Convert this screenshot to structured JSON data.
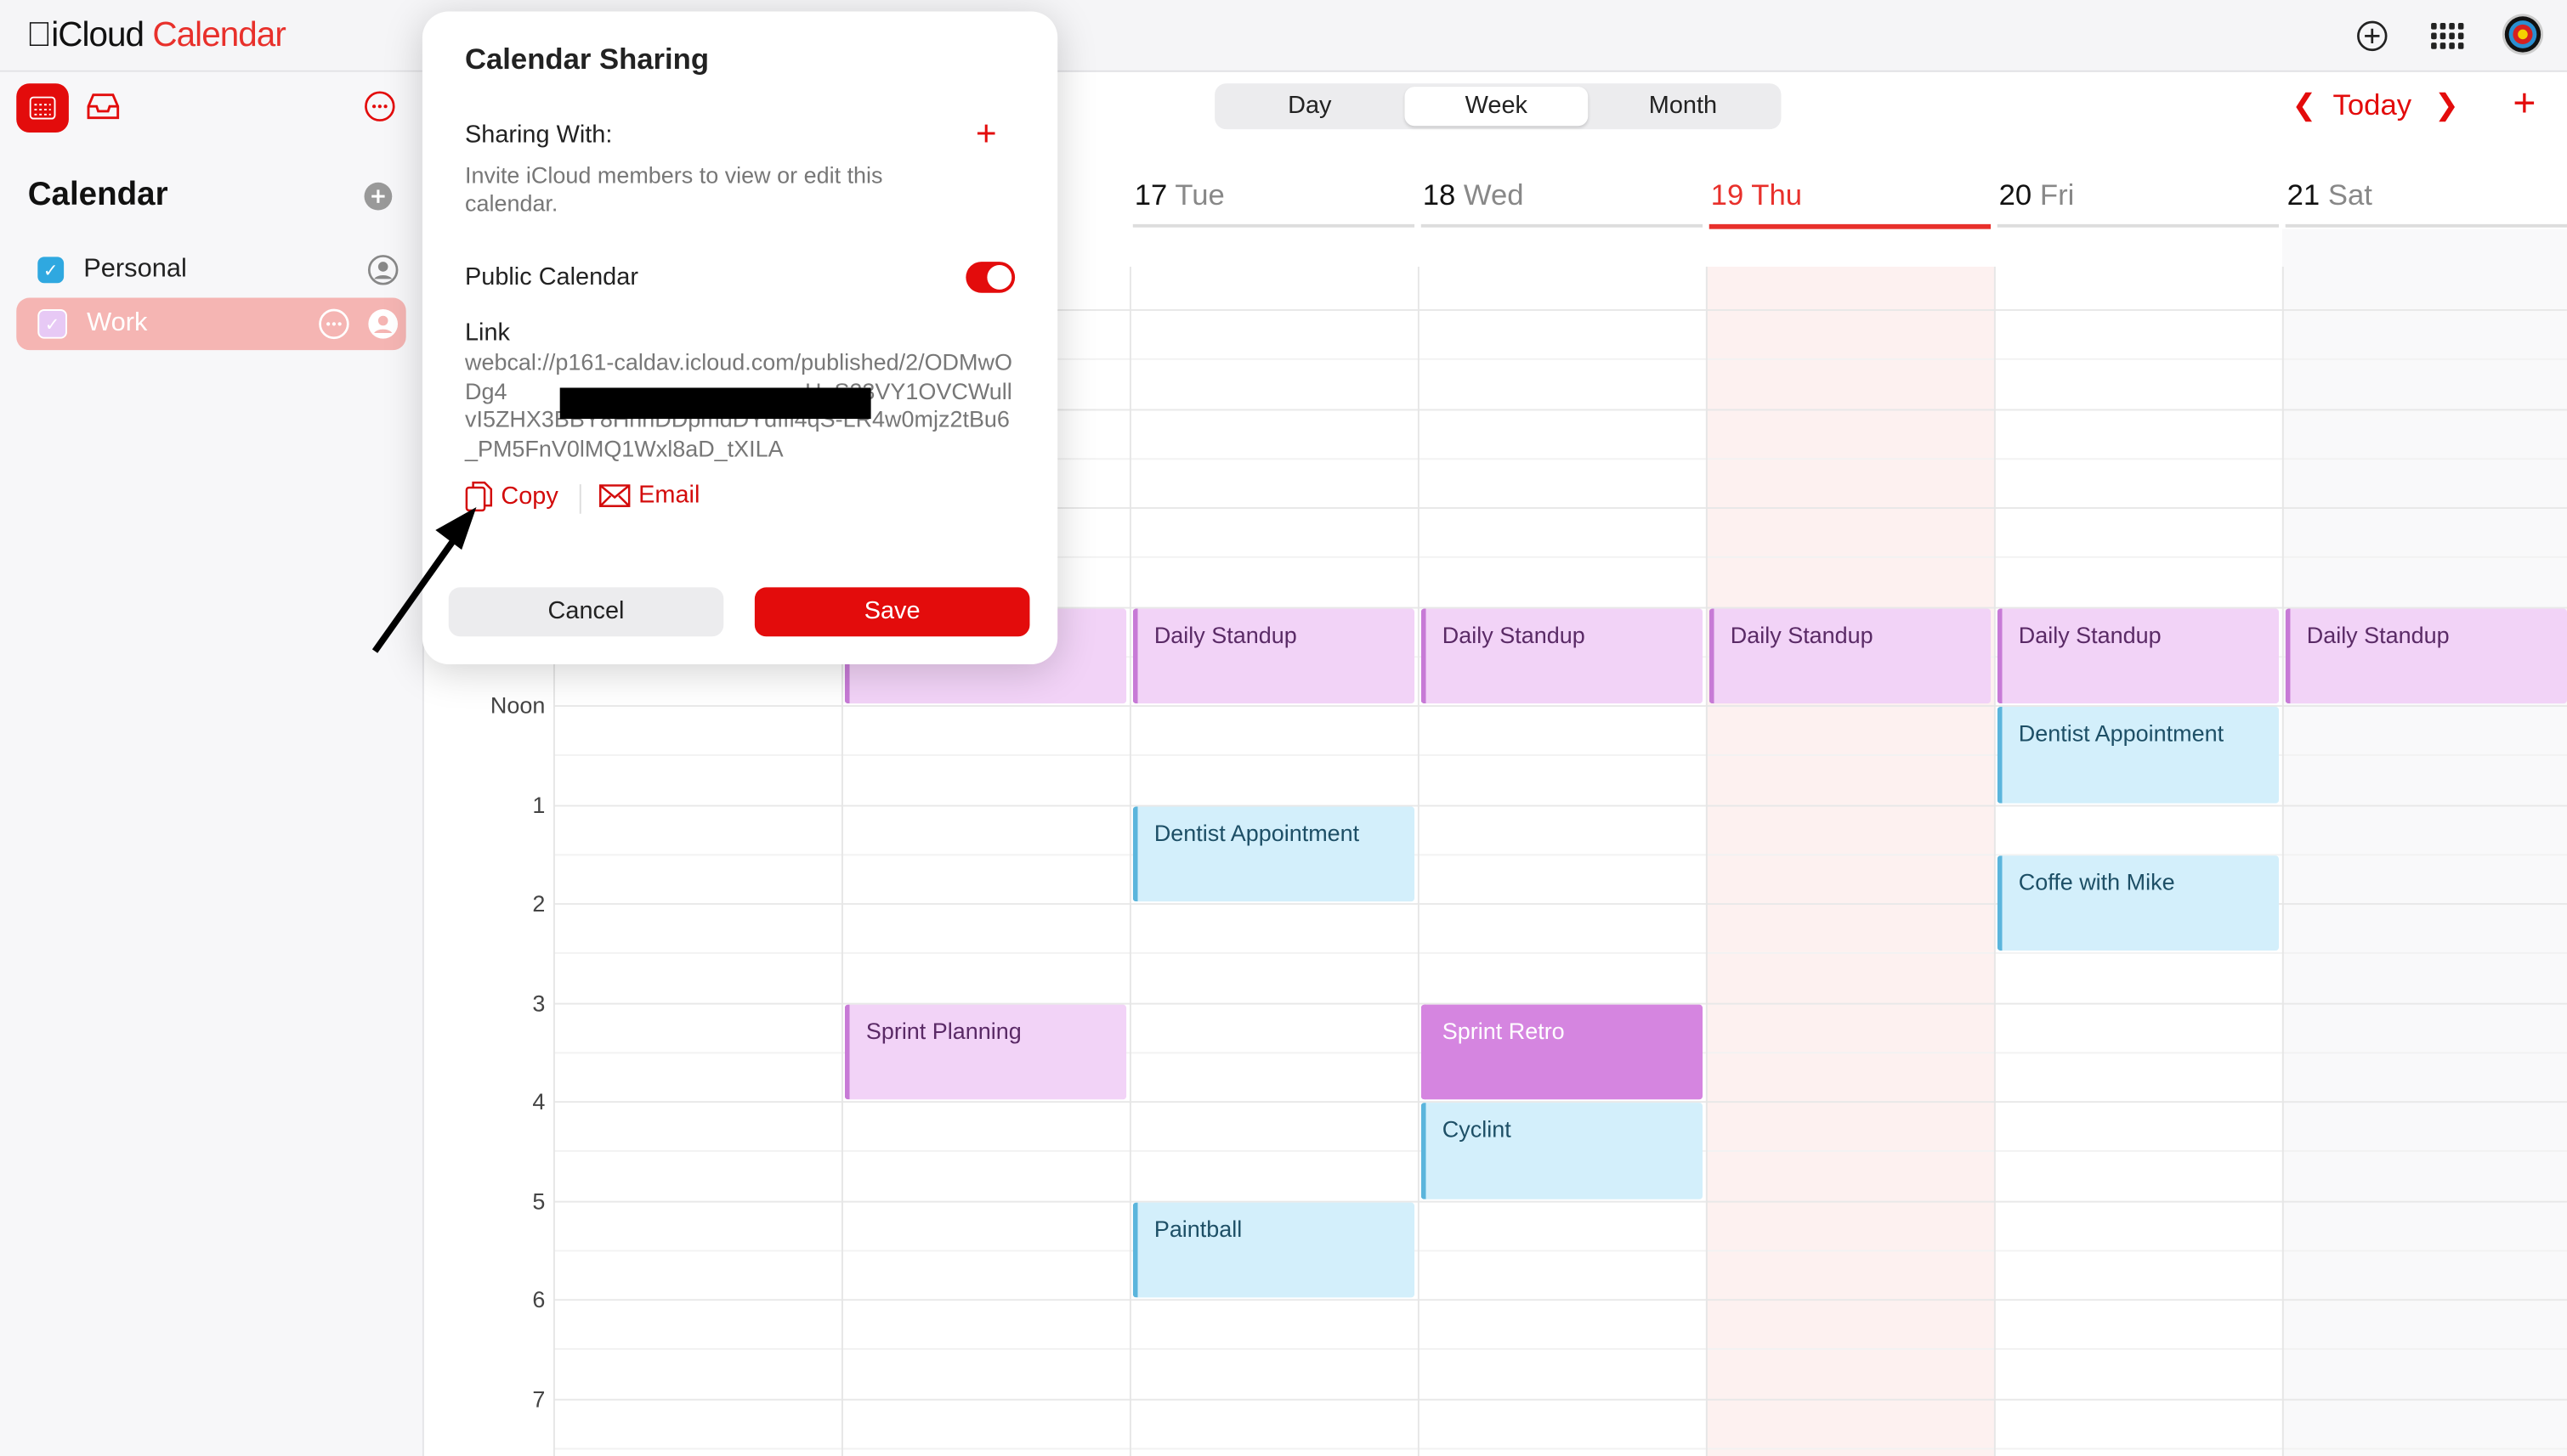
{
  "app": {
    "title_prefix": "iCloud",
    "title_name": "Calendar"
  },
  "topbar": {
    "icons": [
      "add-circle-icon",
      "app-grid-icon",
      "avatar"
    ]
  },
  "sidebar": {
    "heading": "Calendar",
    "calendars": [
      {
        "label": "Personal",
        "color": "#2fa8e0",
        "checked": true
      },
      {
        "label": "Work",
        "color": "#e7c9f5",
        "checked": true,
        "selected": true
      }
    ]
  },
  "toolbar": {
    "views": [
      "Day",
      "Week",
      "Month"
    ],
    "active_view": "Week",
    "today_label": "Today"
  },
  "days": [
    {
      "num": "17",
      "name": "Tue"
    },
    {
      "num": "18",
      "name": "Wed"
    },
    {
      "num": "19",
      "name": "Thu",
      "today": true
    },
    {
      "num": "20",
      "name": "Fri"
    },
    {
      "num": "21",
      "name": "Sat"
    }
  ],
  "time_labels": [
    "Noon",
    "1",
    "2",
    "3",
    "4",
    "5",
    "6",
    "7"
  ],
  "events": [
    {
      "title": "Daily Standup",
      "day": 1,
      "start": 11,
      "end": 12,
      "kind": "work"
    },
    {
      "title": "Daily Standup",
      "day": 2,
      "start": 11,
      "end": 12,
      "kind": "work"
    },
    {
      "title": "Daily Standup",
      "day": 3,
      "start": 11,
      "end": 12,
      "kind": "work"
    },
    {
      "title": "Daily Standup",
      "day": 4,
      "start": 11,
      "end": 12,
      "kind": "work"
    },
    {
      "title": "Daily Standup",
      "day": 5,
      "start": 11,
      "end": 12,
      "kind": "work"
    },
    {
      "title": "Daily Standup",
      "day": 6,
      "start": 11,
      "end": 12,
      "kind": "work"
    },
    {
      "title": "Dentist Appointment",
      "day": 2,
      "start": 13,
      "end": 14,
      "kind": "personal"
    },
    {
      "title": "Dentist Appointment",
      "day": 5,
      "start": 12,
      "end": 13,
      "kind": "personal"
    },
    {
      "title": "Coffe with Mike",
      "day": 5,
      "start": 13.5,
      "end": 14.5,
      "kind": "personal"
    },
    {
      "title": "Sprint Planning",
      "day": 1,
      "start": 15,
      "end": 16,
      "kind": "work"
    },
    {
      "title": "Sprint Retro",
      "day": 3,
      "start": 15,
      "end": 16,
      "kind": "work-selected"
    },
    {
      "title": "Cyclint",
      "day": 3,
      "start": 16,
      "end": 17,
      "kind": "personal"
    },
    {
      "title": "Paintball",
      "day": 2,
      "start": 17,
      "end": 18,
      "kind": "personal"
    }
  ],
  "dialog": {
    "title": "Calendar Sharing",
    "sharing_with_label": "Sharing With:",
    "sharing_hint": "Invite iCloud members to view or edit this calendar.",
    "public_label": "Public Calendar",
    "public_enabled": true,
    "link_label": "Link",
    "link_value": "webcal://p161-caldav.icloud.com/published/2/ODMwODg4             H_S23VY1OVCWullvI5ZHX3BBY8HhhDDpmdDYdffi4qS-LR4w0mjz2tBu6_PM5FnV0lMQ1Wxl8aD_tXILA",
    "copy_label": "Copy",
    "email_label": "Email",
    "cancel_label": "Cancel",
    "save_label": "Save"
  },
  "colors": {
    "accent": "#e30c0c",
    "work_bg": "#f2d3f7",
    "work_border": "#c77ad6",
    "work_selected_bg": "#d585e0",
    "personal_bg": "#d3effb",
    "personal_border": "#5bb5dc",
    "today_bg": "#fdf1f0"
  }
}
